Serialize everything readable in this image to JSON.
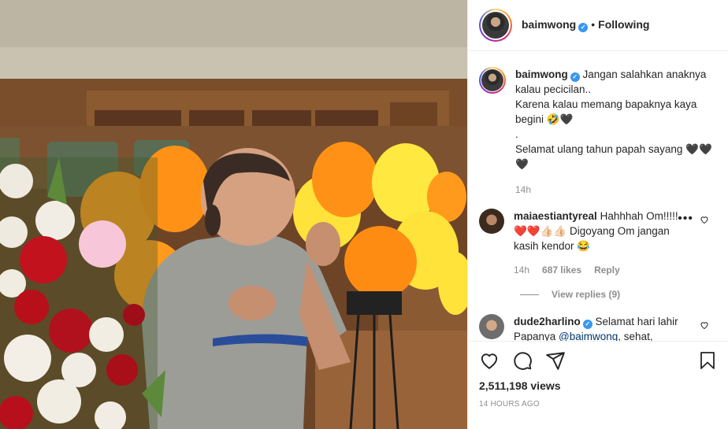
{
  "post": {
    "username": "baimwong",
    "follow_status": "Following",
    "caption": "Jangan salahkan anaknya kalau pecicilan..\nKarena kalau memang bapaknya kaya begini 🤣🖤\n.\nSelamat ulang tahun papah sayang 🖤🖤🖤",
    "caption_time": "14h",
    "views": "2,511,198 views",
    "posted_ago": "14 HOURS AGO"
  },
  "comments": [
    {
      "username": "maiaestiantyreal",
      "text": "Hahhhah Om!!!!! ❤️❤️👍🏻👍🏻 Digoyang Om jangan kasih kendor 😂",
      "time": "14h",
      "likes": "687 likes",
      "reply_label": "Reply",
      "view_replies": "View replies (9)"
    },
    {
      "username": "dude2harlino",
      "text_before": "Selamat hari lahir Papanya ",
      "mention": "@baimwong",
      "text_after": ", sehat,"
    }
  ],
  "icons": [
    "heart-icon",
    "comment-icon",
    "share-icon",
    "bookmark-icon"
  ],
  "colors": {
    "verified": "#3897f0",
    "border": "#efefef",
    "muted": "#8e8e8e",
    "balloon_orange": "#ff9216",
    "balloon_yellow": "#ffe23a"
  }
}
